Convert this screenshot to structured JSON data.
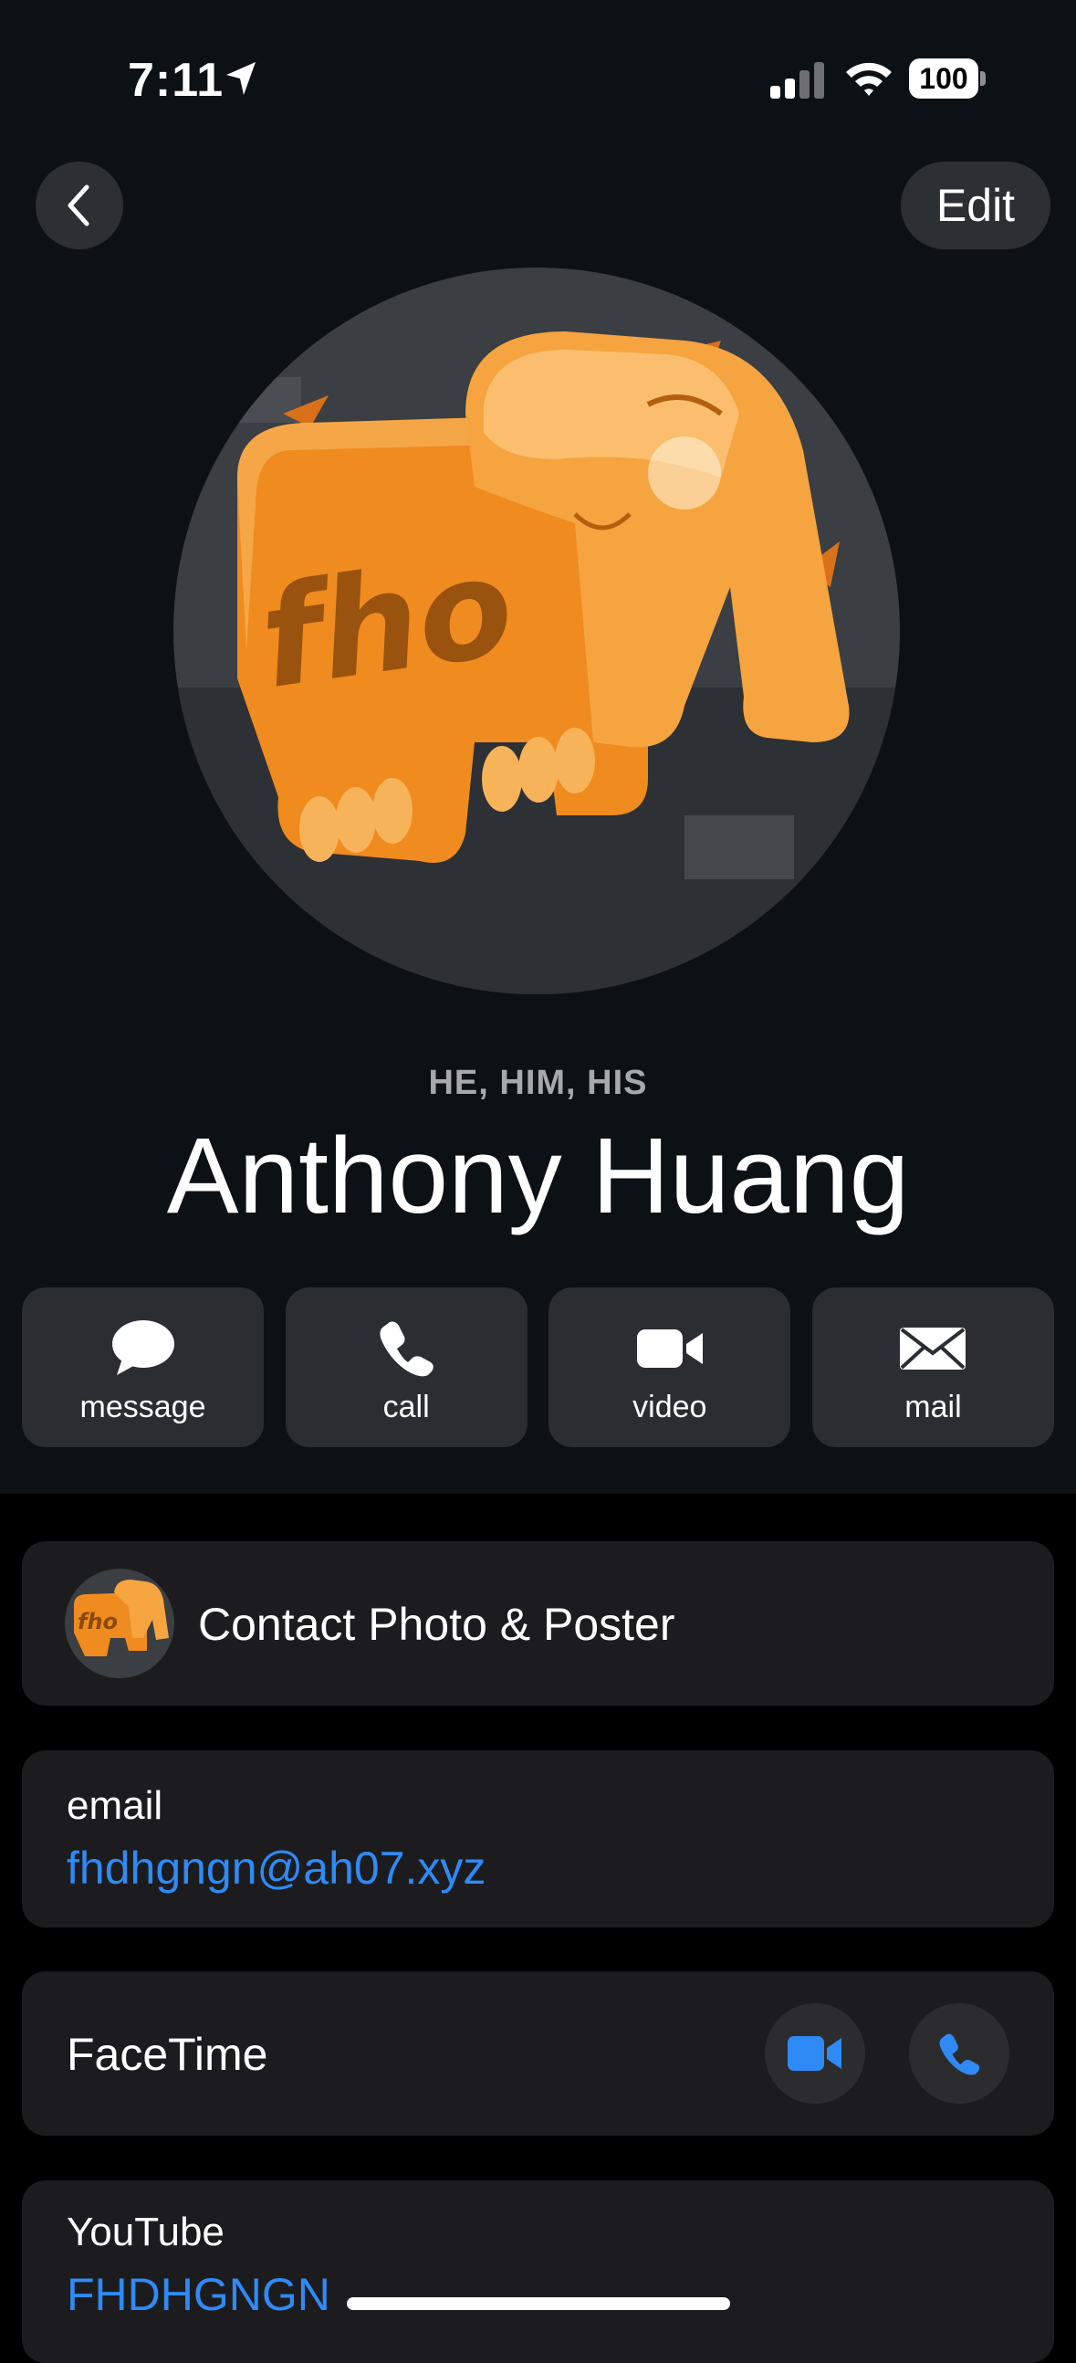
{
  "status_bar": {
    "time": "7:11",
    "battery": "100"
  },
  "nav": {
    "edit_label": "Edit"
  },
  "contact": {
    "pronouns": "HE, HIM, HIS",
    "name": "Anthony Huang",
    "avatar_text": "fho"
  },
  "actions": [
    {
      "label": "message",
      "icon": "message-bubble-icon"
    },
    {
      "label": "call",
      "icon": "phone-icon"
    },
    {
      "label": "video",
      "icon": "video-camera-icon"
    },
    {
      "label": "mail",
      "icon": "envelope-icon"
    }
  ],
  "photo_card": {
    "label": "Contact Photo & Poster"
  },
  "email_card": {
    "label": "email",
    "value": "fhdhgngn@ah07.xyz"
  },
  "facetime_card": {
    "label": "FaceTime"
  },
  "youtube_card": {
    "label": "YouTube",
    "value": "FHDHGNGN"
  },
  "colors": {
    "accent": "#2f8af5",
    "hero_bg": "#0c1116",
    "card_bg": "#1c1c1e",
    "avatar_orange": "#f39a2c"
  }
}
